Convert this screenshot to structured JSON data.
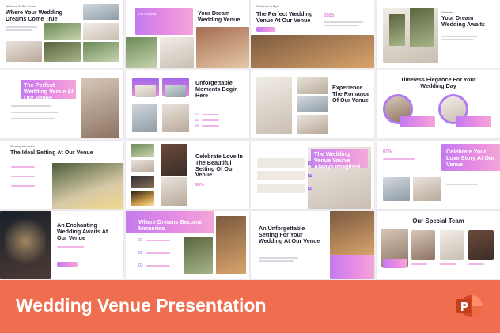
{
  "footer": {
    "title": "Wedding Venue Presentation"
  },
  "colors": {
    "accent_purple": "#9a5be6",
    "accent_pink": "#e57ad7",
    "footer_bg": "#ef6e4f"
  },
  "slides": {
    "s1": {
      "kicker": "Welcome To Our Venue",
      "title": "Where Your Wedding Dreams Come True"
    },
    "s2": {
      "tag": "Our Company",
      "title": "Your Dream Wedding Venue"
    },
    "s3": {
      "kicker": "Celebrate In Style",
      "title": "The Perfect Wedding Venue At Our Venue",
      "year": "2025"
    },
    "s4": {
      "kicker": "Overview",
      "title": "Your Dream Wedding Awaits"
    },
    "s5": {
      "title": "The Perfect Wedding Venue At Our Venue"
    },
    "s6": {
      "title": "Unforgettable Moments Begin Here",
      "n1": "01",
      "n2": "02",
      "n3": "03"
    },
    "s7": {
      "title": "Experience The Romance Of Our Venue"
    },
    "s8": {
      "title": "Timeless Elegance For Your Wedding Day"
    },
    "s9": {
      "kicker": "Creating Memories",
      "title": "The Ideal Setting At Our Venue"
    },
    "s10": {
      "title": "Celebrate Love In The Beautiful Setting Of Our Venue",
      "pct": "99%"
    },
    "s11": {
      "title": "The Wedding Venue You've Always Imagined",
      "n1": "01",
      "n2": "02",
      "n3": "03"
    },
    "s12": {
      "pct": "87%",
      "title": "Celebrate Your Love Story At Our Venue"
    },
    "s13": {
      "title": "An Enchanting Wedding Awaits At Our Venue"
    },
    "s14": {
      "title": "Where Dreams Become Memories",
      "n1": "01",
      "n2": "02",
      "n3": "03"
    },
    "s15": {
      "title": "An Unforgettable Setting For Your Wedding At Our Venue"
    },
    "s16": {
      "title": "Our Special Team"
    }
  }
}
